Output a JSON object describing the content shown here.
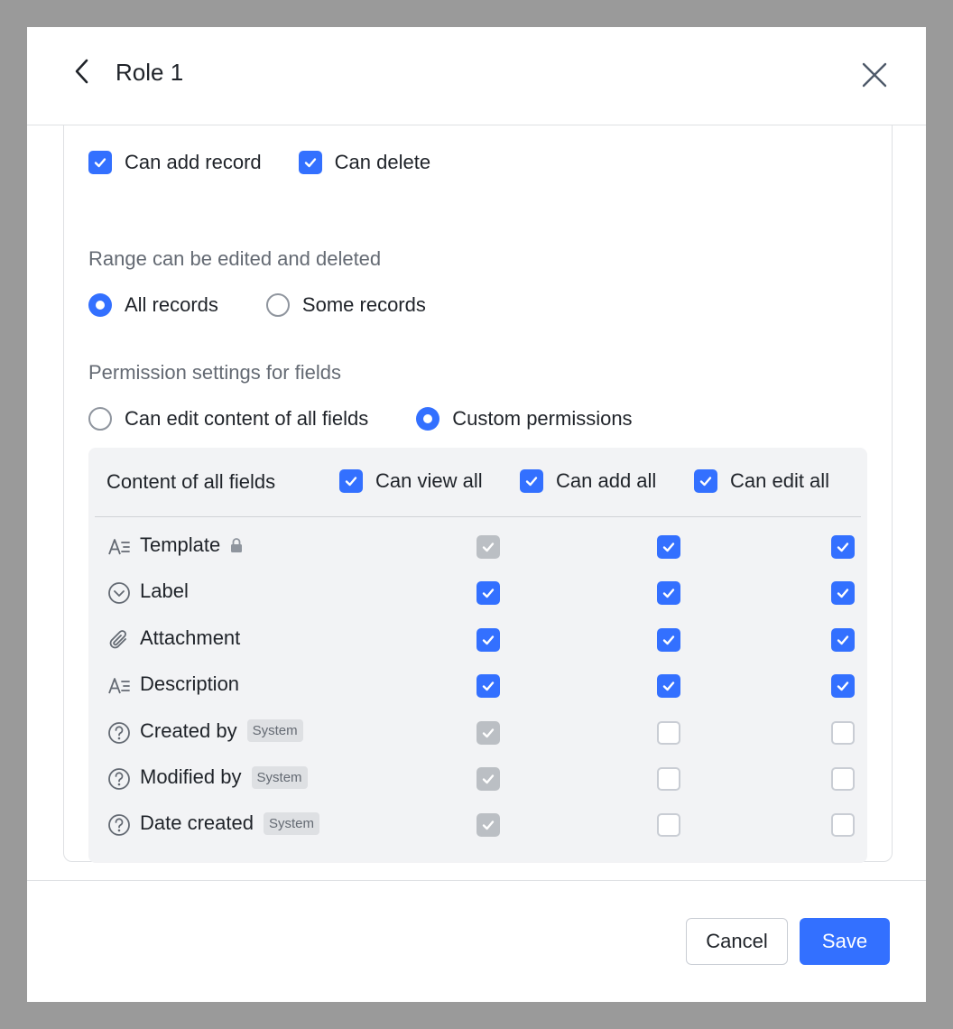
{
  "header": {
    "title": "Role 1"
  },
  "record_permissions": {
    "can_add_label": "Can add record",
    "can_add_checked": true,
    "can_delete_label": "Can delete",
    "can_delete_checked": true
  },
  "range": {
    "label": "Range can be edited and deleted",
    "options": [
      {
        "label": "All records",
        "selected": true
      },
      {
        "label": "Some records",
        "selected": false
      }
    ]
  },
  "field_permissions": {
    "label": "Permission settings for fields",
    "options": [
      {
        "label": "Can edit content of all fields",
        "selected": false
      },
      {
        "label": "Custom permissions",
        "selected": true
      }
    ]
  },
  "table": {
    "header_label": "Content of all fields",
    "columns": [
      {
        "label": "Can view all",
        "checked": true
      },
      {
        "label": "Can add all",
        "checked": true
      },
      {
        "label": "Can edit all",
        "checked": true
      }
    ],
    "rows": [
      {
        "name": "Template",
        "icon": "text-field-icon",
        "badge": "",
        "locked": true,
        "view": "disabled",
        "add": "on",
        "edit": "on"
      },
      {
        "name": "Label",
        "icon": "single-select-icon",
        "badge": "",
        "locked": false,
        "view": "on",
        "add": "on",
        "edit": "on"
      },
      {
        "name": "Attachment",
        "icon": "attachment-icon",
        "badge": "",
        "locked": false,
        "view": "on",
        "add": "on",
        "edit": "on"
      },
      {
        "name": "Description",
        "icon": "text-field-icon",
        "badge": "",
        "locked": false,
        "view": "on",
        "add": "on",
        "edit": "on"
      },
      {
        "name": "Created by",
        "icon": "help-circle-icon",
        "badge": "System",
        "locked": false,
        "view": "disabled",
        "add": "off",
        "edit": "off"
      },
      {
        "name": "Modified by",
        "icon": "help-circle-icon",
        "badge": "System",
        "locked": false,
        "view": "disabled",
        "add": "off",
        "edit": "off"
      },
      {
        "name": "Date created",
        "icon": "help-circle-icon",
        "badge": "System",
        "locked": false,
        "view": "disabled",
        "add": "off",
        "edit": "off"
      }
    ]
  },
  "footer": {
    "cancel_label": "Cancel",
    "save_label": "Save"
  },
  "colors": {
    "accent": "#3370ff",
    "disabled": "#bbbfc4",
    "border": "#dee0e3",
    "table_bg": "#f2f3f5"
  }
}
